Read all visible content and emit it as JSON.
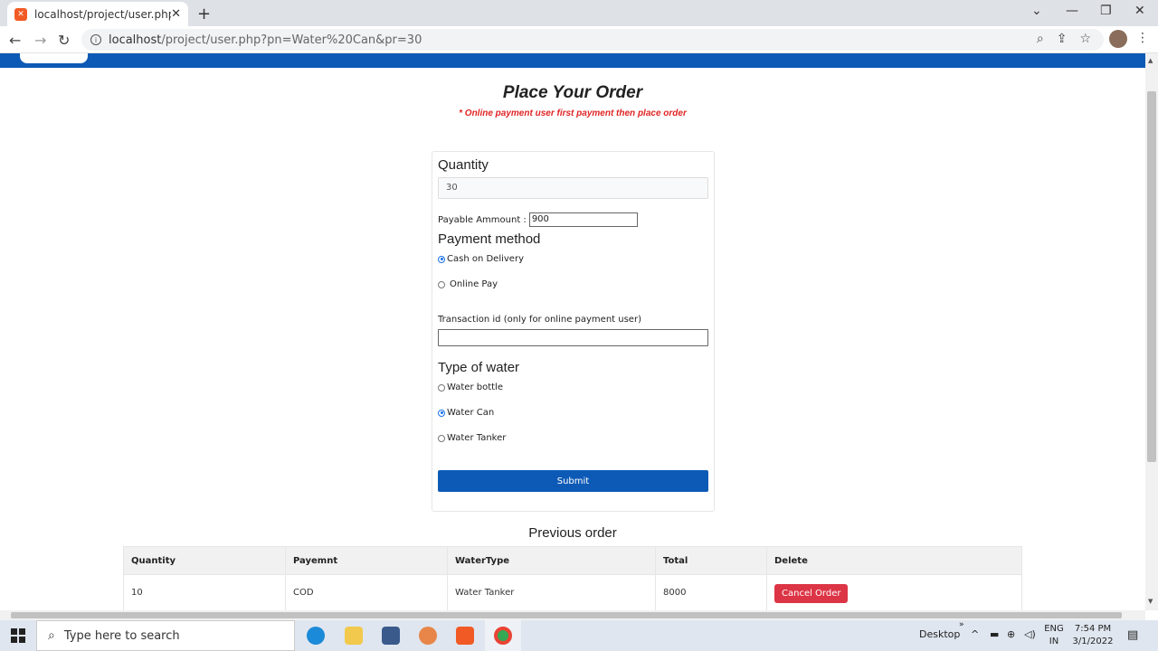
{
  "browser": {
    "tab_title": "localhost/project/user.php?pn=W",
    "tab_close": "✕",
    "new_tab": "+",
    "url_main": "localhost",
    "url_rest": "/project/user.php?pn=Water%20Can&pr=30",
    "controls": {
      "minimize": "—",
      "maximize": "❐",
      "close": "✕",
      "chevron": "⌄"
    },
    "nav": {
      "back": "←",
      "forward": "→",
      "reload": "↻"
    },
    "omni_icons": {
      "zoom": "⌕",
      "share": "⇪",
      "star": "☆"
    },
    "kebab": "⋮"
  },
  "page": {
    "title": "Place Your Order",
    "note": "* Online payment user first payment then place order",
    "form": {
      "quantity_heading": "Quantity",
      "quantity_value": "30",
      "payable_label": "Payable Ammount :",
      "payable_value": "900",
      "payment_heading": "Payment method",
      "payment_options": [
        {
          "label": "Cash on Delivery",
          "selected": true
        },
        {
          "label": "Online Pay",
          "selected": false
        }
      ],
      "transaction_label": "Transaction id (only for online payment user)",
      "water_heading": "Type of water",
      "water_options": [
        {
          "label": "Water bottle",
          "selected": false
        },
        {
          "label": "Water Can",
          "selected": true
        },
        {
          "label": "Water Tanker",
          "selected": false
        }
      ],
      "submit_label": "Submit"
    },
    "previous_title": "Previous order",
    "table": {
      "headers": [
        "Quantity",
        "Payemnt",
        "WaterType",
        "Total",
        "Delete"
      ],
      "rows": [
        {
          "quantity": "10",
          "payment": "COD",
          "water_type": "Water Tanker",
          "total": "8000",
          "action": "Cancel Order"
        }
      ]
    }
  },
  "taskbar": {
    "search_placeholder": "Type here to search",
    "desktop_label": "Desktop",
    "chevrons": "»",
    "lang_top": "ENG",
    "lang_bottom": "IN",
    "time": "7:54 PM",
    "date": "3/1/2022"
  },
  "colors": {
    "brand_blue": "#0d5ab6",
    "danger_red": "#dc3545",
    "note_red": "#e02424"
  }
}
